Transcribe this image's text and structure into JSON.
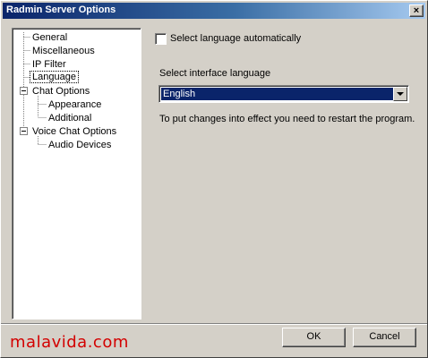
{
  "window": {
    "title": "Radmin Server Options",
    "close_glyph": "×"
  },
  "tree": {
    "items": [
      {
        "label": "General"
      },
      {
        "label": "Miscellaneous"
      },
      {
        "label": "IP Filter"
      },
      {
        "label": "Language",
        "selected": true
      },
      {
        "label": "Chat Options",
        "expanded": true
      },
      {
        "label": "Appearance"
      },
      {
        "label": "Additional"
      },
      {
        "label": "Voice Chat Options",
        "expanded": true
      },
      {
        "label": "Audio Devices"
      }
    ]
  },
  "panel": {
    "auto_language_label": "Select language automatically",
    "auto_language_checked": false,
    "interface_language_label": "Select interface language",
    "interface_language_value": "English",
    "restart_hint": "To put changes into effect you need to restart the program."
  },
  "buttons": {
    "ok_label": "OK",
    "cancel_label": "Cancel"
  },
  "watermark": {
    "text": "malavida.com"
  },
  "colors": {
    "titlebar_start": "#0a246a",
    "titlebar_end": "#a6caf0",
    "selection": "#0a246a",
    "watermark": "#d30000",
    "face": "#d4d0c8"
  }
}
